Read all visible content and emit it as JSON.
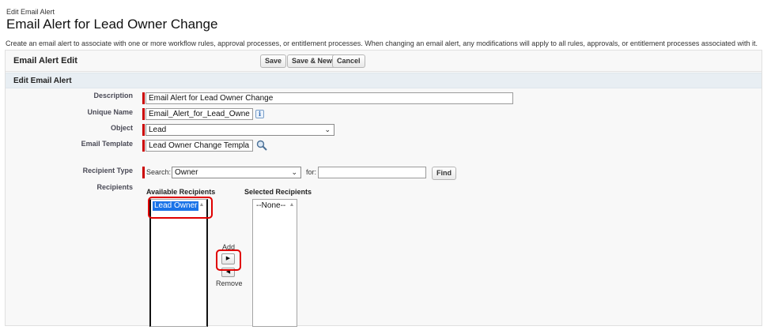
{
  "header": {
    "breadcrumb": "Edit Email Alert",
    "title": "Email Alert for Lead Owner Change",
    "description": "Create an email alert to associate with one or more workflow rules, approval processes, or entitlement processes. When changing an email alert, any modifications will apply to all rules, approvals, or entitlement processes associated with it."
  },
  "panel": {
    "title": "Email Alert Edit",
    "buttons": {
      "save": "Save",
      "save_new": "Save & New",
      "cancel": "Cancel"
    },
    "section_title": "Edit Email Alert"
  },
  "form": {
    "description": {
      "label": "Description",
      "value": "Email Alert for Lead Owner Change"
    },
    "unique_name": {
      "label": "Unique Name",
      "value": "Email_Alert_for_Lead_Owne"
    },
    "object": {
      "label": "Object",
      "value": "Lead"
    },
    "email_template": {
      "label": "Email Template",
      "value": "Lead Owner Change Templa"
    },
    "recipient_type": {
      "label": "Recipient Type",
      "search_label": "Search:",
      "search_value": "Owner",
      "for_label": "for:",
      "for_value": "",
      "find_button": "Find"
    },
    "recipients": {
      "label": "Recipients",
      "available_heading": "Available Recipients",
      "available_items": [
        "Lead Owner"
      ],
      "selected_heading": "Selected Recipients",
      "selected_items": [
        "--None--"
      ],
      "add_label": "Add",
      "remove_label": "Remove"
    }
  },
  "icons": {
    "info": "info-icon",
    "lookup": "lookup-icon",
    "add": "arrow-right-icon",
    "remove": "arrow-left-icon"
  },
  "colors": {
    "required": "#cc0000",
    "highlight": "#e00000",
    "selection": "#1a73e8"
  }
}
